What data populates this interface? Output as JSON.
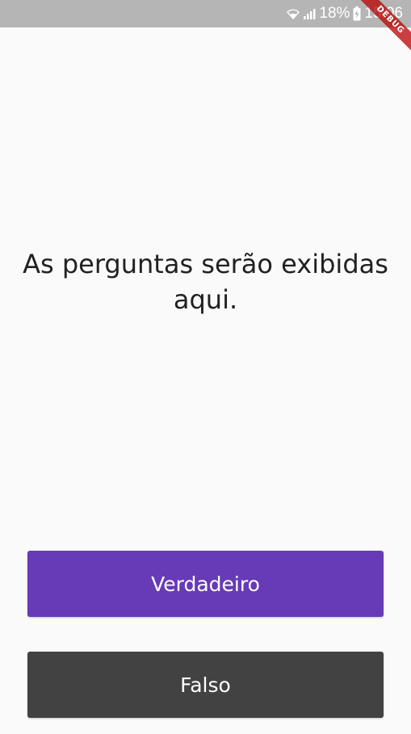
{
  "status_bar": {
    "battery_percent": "18%",
    "time": "15:06",
    "icons": [
      "wifi-icon",
      "signal-icon",
      "battery-charging-icon"
    ]
  },
  "debug_banner": {
    "label": "DEBUG"
  },
  "quiz": {
    "question_text": "As perguntas serão exibidas aqui.",
    "true_button_label": "Verdadeiro",
    "false_button_label": "Falso"
  },
  "colors": {
    "status_bar": "#b5b5b5",
    "background": "#fafafa",
    "true_button": "#673ab7",
    "false_button": "#424242",
    "debug_ribbon": "#b80000"
  }
}
